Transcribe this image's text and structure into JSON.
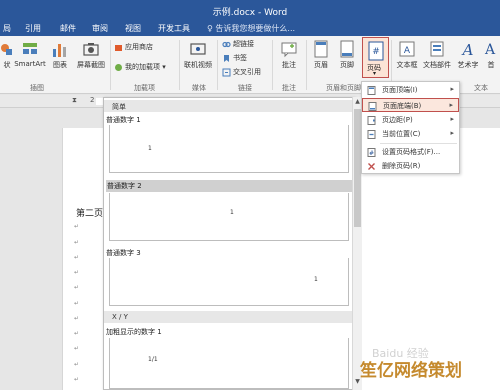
{
  "window": {
    "title": "示例.docx - Word"
  },
  "tabs": [
    "局",
    "引用",
    "邮件",
    "审阅",
    "视图",
    "开发工具",
    "♀ 告诉我您想要做什么..."
  ],
  "ribbon": {
    "buttons": {
      "shape": "状",
      "smartart": "SmartArt",
      "chart": "图表",
      "screenshot": "屏幕截图",
      "store": "应用商店",
      "myaddins": "我的加载项",
      "video": "联机视频",
      "hyperlink": "超链接",
      "bookmark": "书签",
      "crossref": "交叉引用",
      "comment": "批注",
      "header": "页眉",
      "footer": "页脚",
      "pagenum": "页码",
      "textbox": "文本框",
      "quickparts": "文档部件",
      "wordart": "艺术字",
      "dropcap": "首"
    },
    "groups": {
      "illustrations": "插图",
      "addins": "加载项",
      "media": "媒体",
      "links": "链接",
      "comments": "批注",
      "headerfooter": "页眉和页脚",
      "text": "文本"
    }
  },
  "ruler": {
    "left": "2",
    "right": "2"
  },
  "document": {
    "heading": "第二页",
    "marker": "↵"
  },
  "gallery": {
    "category_simple": "简单",
    "items": [
      {
        "label": "普通数字 1",
        "digit": "1"
      },
      {
        "label": "普通数字 2",
        "digit": "1"
      },
      {
        "label": "普通数字 3",
        "digit": "1"
      }
    ],
    "category_xy": "X / Y",
    "bold_item": {
      "label": "加粗显示的数字 1",
      "digit": "1/1"
    }
  },
  "menu": {
    "items": [
      {
        "label": "页面顶端(I)",
        "arrow": "▸"
      },
      {
        "label": "页面底端(B)",
        "arrow": "▸"
      },
      {
        "label": "页边距(P)",
        "arrow": "▸"
      },
      {
        "label": "当前位置(C)",
        "arrow": "▸"
      },
      {
        "label": "设置页码格式(F)...",
        "arrow": ""
      },
      {
        "label": "删除页码(R)",
        "arrow": ""
      }
    ]
  },
  "watermark": {
    "text": "笙亿网络策划",
    "faint": "Baidu 经验"
  },
  "colors": {
    "accent": "#2b579a",
    "highlight": "#c0504d"
  }
}
